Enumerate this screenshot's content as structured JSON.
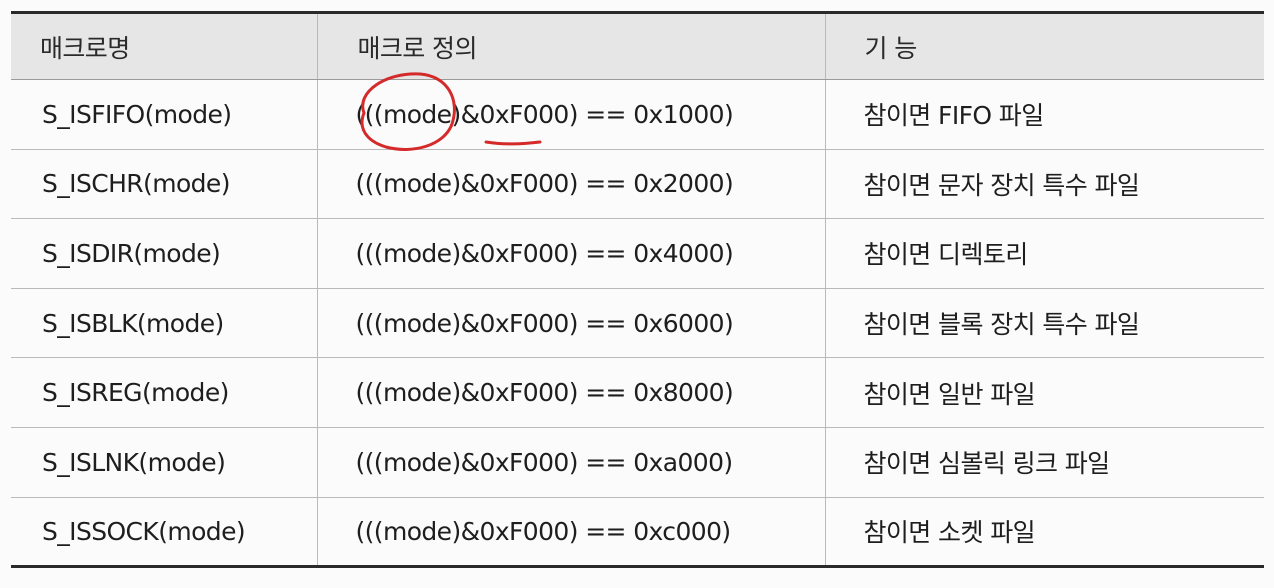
{
  "table": {
    "headers": [
      "매크로명",
      "매크로 정의",
      "기 능"
    ],
    "rows": [
      {
        "name": "S_ISFIFO(mode)",
        "definition": "(((mode)&0xF000) == 0x1000)",
        "function": "참이면 FIFO 파일"
      },
      {
        "name": "S_ISCHR(mode)",
        "definition": "(((mode)&0xF000) == 0x2000)",
        "function": "참이면 문자 장치 특수 파일"
      },
      {
        "name": "S_ISDIR(mode)",
        "definition": "(((mode)&0xF000) == 0x4000)",
        "function": "참이면 디렉토리"
      },
      {
        "name": "S_ISBLK(mode)",
        "definition": "(((mode)&0xF000) == 0x6000)",
        "function": "참이면 블록 장치 특수 파일"
      },
      {
        "name": "S_ISREG(mode)",
        "definition": "(((mode)&0xF000) == 0x8000)",
        "function": "참이면 일반 파일"
      },
      {
        "name": "S_ISLNK(mode)",
        "definition": "(((mode)&0xF000) == 0xa000)",
        "function": "참이면 심볼릭 링크 파일"
      },
      {
        "name": "S_ISSOCK(mode)",
        "definition": "(((mode)&0xF000) == 0xc000)",
        "function": "참이면 소켓 파일"
      }
    ]
  },
  "annotation_color": "#d42a2a"
}
